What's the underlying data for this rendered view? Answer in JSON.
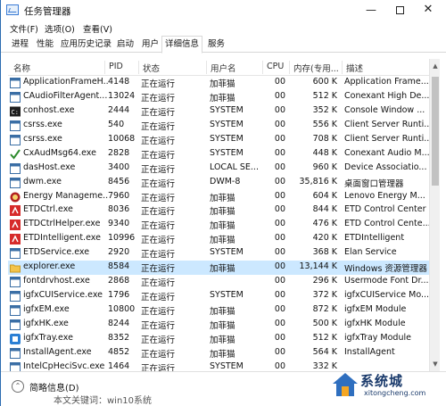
{
  "window": {
    "title": "任务管理器",
    "controls": {
      "minimize": "—",
      "maximize": "□",
      "close": "✕"
    }
  },
  "menu": [
    "文件(F)",
    "选项(O)",
    "查看(V)"
  ],
  "tabs": [
    {
      "label": "进程",
      "active": false
    },
    {
      "label": "性能",
      "active": false
    },
    {
      "label": "应用历史记录",
      "active": false
    },
    {
      "label": "启动",
      "active": false
    },
    {
      "label": "用户",
      "active": false
    },
    {
      "label": "详细信息",
      "active": true
    },
    {
      "label": "服务",
      "active": false
    }
  ],
  "table": {
    "columns": {
      "name": "名称",
      "pid": "PID",
      "status": "状态",
      "user": "用户名",
      "cpu": "CPU",
      "memory": "内存(专用...",
      "description": "描述"
    },
    "rows": [
      {
        "icon": "window-icon",
        "name": "ApplicationFrameH...",
        "pid": "4148",
        "status": "正在运行",
        "user": "加菲猫",
        "cpu": "00",
        "memory": "600 K",
        "description": "Application Frame..."
      },
      {
        "icon": "window-icon",
        "name": "CAudioFilterAgent...",
        "pid": "13024",
        "status": "正在运行",
        "user": "加菲猫",
        "cpu": "00",
        "memory": "512 K",
        "description": "Conexant High De..."
      },
      {
        "icon": "console-icon",
        "name": "conhost.exe",
        "pid": "2444",
        "status": "正在运行",
        "user": "SYSTEM",
        "cpu": "00",
        "memory": "352 K",
        "description": "Console Window ..."
      },
      {
        "icon": "window-icon",
        "name": "csrss.exe",
        "pid": "540",
        "status": "正在运行",
        "user": "SYSTEM",
        "cpu": "00",
        "memory": "556 K",
        "description": "Client Server Runti..."
      },
      {
        "icon": "window-icon",
        "name": "csrss.exe",
        "pid": "10068",
        "status": "正在运行",
        "user": "SYSTEM",
        "cpu": "00",
        "memory": "708 K",
        "description": "Client Server Runti..."
      },
      {
        "icon": "audio-check-icon",
        "name": "CxAudMsg64.exe",
        "pid": "2828",
        "status": "正在运行",
        "user": "SYSTEM",
        "cpu": "00",
        "memory": "448 K",
        "description": "Conexant Audio M..."
      },
      {
        "icon": "window-icon",
        "name": "dasHost.exe",
        "pid": "3400",
        "status": "正在运行",
        "user": "LOCAL SE...",
        "cpu": "00",
        "memory": "960 K",
        "description": "Device Associatio..."
      },
      {
        "icon": "window-icon",
        "name": "dwm.exe",
        "pid": "8456",
        "status": "正在运行",
        "user": "DWM-8",
        "cpu": "00",
        "memory": "35,816 K",
        "description": "桌面窗口管理器"
      },
      {
        "icon": "energy-icon",
        "name": "Energy Manageme...",
        "pid": "7960",
        "status": "正在运行",
        "user": "加菲猫",
        "cpu": "00",
        "memory": "604 K",
        "description": "Lenovo Energy M..."
      },
      {
        "icon": "etd-icon",
        "name": "ETDCtrl.exe",
        "pid": "8036",
        "status": "正在运行",
        "user": "加菲猫",
        "cpu": "00",
        "memory": "844 K",
        "description": "ETD Control Center"
      },
      {
        "icon": "etd-icon",
        "name": "ETDCtrlHelper.exe",
        "pid": "9340",
        "status": "正在运行",
        "user": "加菲猫",
        "cpu": "00",
        "memory": "476 K",
        "description": "ETD Control Cente..."
      },
      {
        "icon": "etd-icon",
        "name": "ETDIntelligent.exe",
        "pid": "10996",
        "status": "正在运行",
        "user": "加菲猫",
        "cpu": "00",
        "memory": "420 K",
        "description": "ETDIntelligent"
      },
      {
        "icon": "window-icon",
        "name": "ETDService.exe",
        "pid": "2920",
        "status": "正在运行",
        "user": "SYSTEM",
        "cpu": "00",
        "memory": "368 K",
        "description": "Elan Service"
      },
      {
        "icon": "folder-icon",
        "name": "explorer.exe",
        "pid": "8584",
        "status": "正在运行",
        "user": "加菲猫",
        "cpu": "00",
        "memory": "13,144 K",
        "description": "Windows 资源管理器",
        "selected": true
      },
      {
        "icon": "window-icon",
        "name": "fontdrvhost.exe",
        "pid": "2868",
        "status": "正在运行",
        "user": "",
        "cpu": "00",
        "memory": "296 K",
        "description": "Usermode Font Dr..."
      },
      {
        "icon": "window-icon",
        "name": "igfxCUIService.exe",
        "pid": "1796",
        "status": "正在运行",
        "user": "SYSTEM",
        "cpu": "00",
        "memory": "372 K",
        "description": "igfxCUIService Mo..."
      },
      {
        "icon": "window-icon",
        "name": "igfxEM.exe",
        "pid": "10800",
        "status": "正在运行",
        "user": "加菲猫",
        "cpu": "00",
        "memory": "872 K",
        "description": "igfxEM Module"
      },
      {
        "icon": "window-icon",
        "name": "igfxHK.exe",
        "pid": "8244",
        "status": "正在运行",
        "user": "加菲猫",
        "cpu": "00",
        "memory": "500 K",
        "description": "igfxHK Module"
      },
      {
        "icon": "tray-icon",
        "name": "igfxTray.exe",
        "pid": "8352",
        "status": "正在运行",
        "user": "加菲猫",
        "cpu": "00",
        "memory": "512 K",
        "description": "igfxTray Module"
      },
      {
        "icon": "window-icon",
        "name": "InstallAgent.exe",
        "pid": "4852",
        "status": "正在运行",
        "user": "加菲猫",
        "cpu": "00",
        "memory": "564 K",
        "description": "InstallAgent"
      },
      {
        "icon": "window-icon",
        "name": "IntelCpHeciSvc.exe",
        "pid": "1464",
        "status": "正在运行",
        "user": "SYSTEM",
        "cpu": "00",
        "memory": "332 K",
        "description": ""
      }
    ]
  },
  "footer": {
    "fewer_details": "简略信息(D)"
  },
  "background_text": "本文关键词：win10系统",
  "watermark": {
    "text": "系统城",
    "url": "xitongcheng.com"
  },
  "colors": {
    "selected_row": "#cce8ff",
    "accent": "#2b6cb0"
  }
}
